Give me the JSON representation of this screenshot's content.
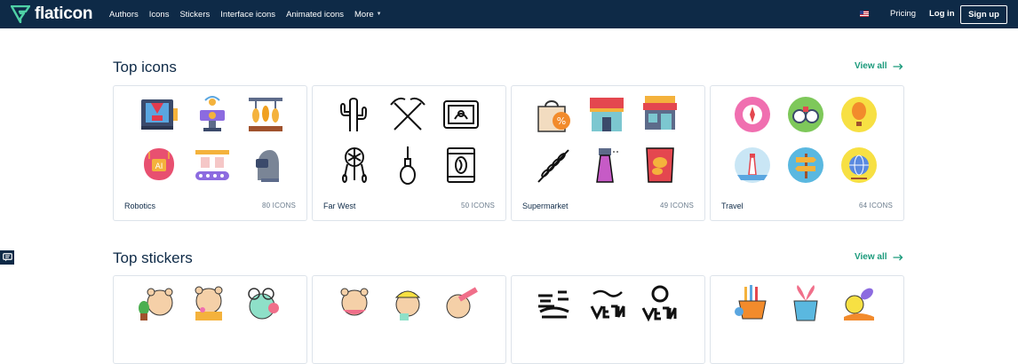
{
  "header": {
    "logo_text": "flaticon",
    "nav": [
      "Authors",
      "Icons",
      "Stickers",
      "Interface icons",
      "Animated icons",
      "More"
    ],
    "pricing": "Pricing",
    "login": "Log in",
    "signup": "Sign up"
  },
  "top_icons": {
    "title": "Top icons",
    "view_all": "View all",
    "packs": [
      {
        "name": "Robotics",
        "count": "80 ICONS",
        "icons": [
          "3d-printer-icon",
          "signal-device-icon",
          "robotic-wheat-harvester-icon",
          "ai-brain-icon",
          "conveyor-belt-icon",
          "robot-head-icon"
        ]
      },
      {
        "name": "Far West",
        "count": "50 ICONS",
        "icons": [
          "cactus-icon",
          "crossed-pickaxes-icon",
          "wanted-poster-icon",
          "dreamcatcher-icon",
          "noose-icon",
          "bean-sack-icon"
        ]
      },
      {
        "name": "Supermarket",
        "count": "49 ICONS",
        "icons": [
          "discount-bag-icon",
          "storefront-icon",
          "supermarket-building-icon",
          "wheat-icon",
          "spray-bottle-icon",
          "chips-bag-icon"
        ]
      },
      {
        "name": "Travel",
        "count": "64 ICONS",
        "icons": [
          "compass-icon",
          "binoculars-icon",
          "hot-air-balloon-icon",
          "lighthouse-icon",
          "signpost-icon",
          "globe-icon"
        ]
      }
    ]
  },
  "top_stickers": {
    "title": "Top stickers",
    "view_all": "View all"
  },
  "colors": {
    "header_bg": "#0e2a47",
    "accent": "#1a9a7b",
    "text_dark": "#0e2a47",
    "count_gray": "#6a7b8c"
  }
}
